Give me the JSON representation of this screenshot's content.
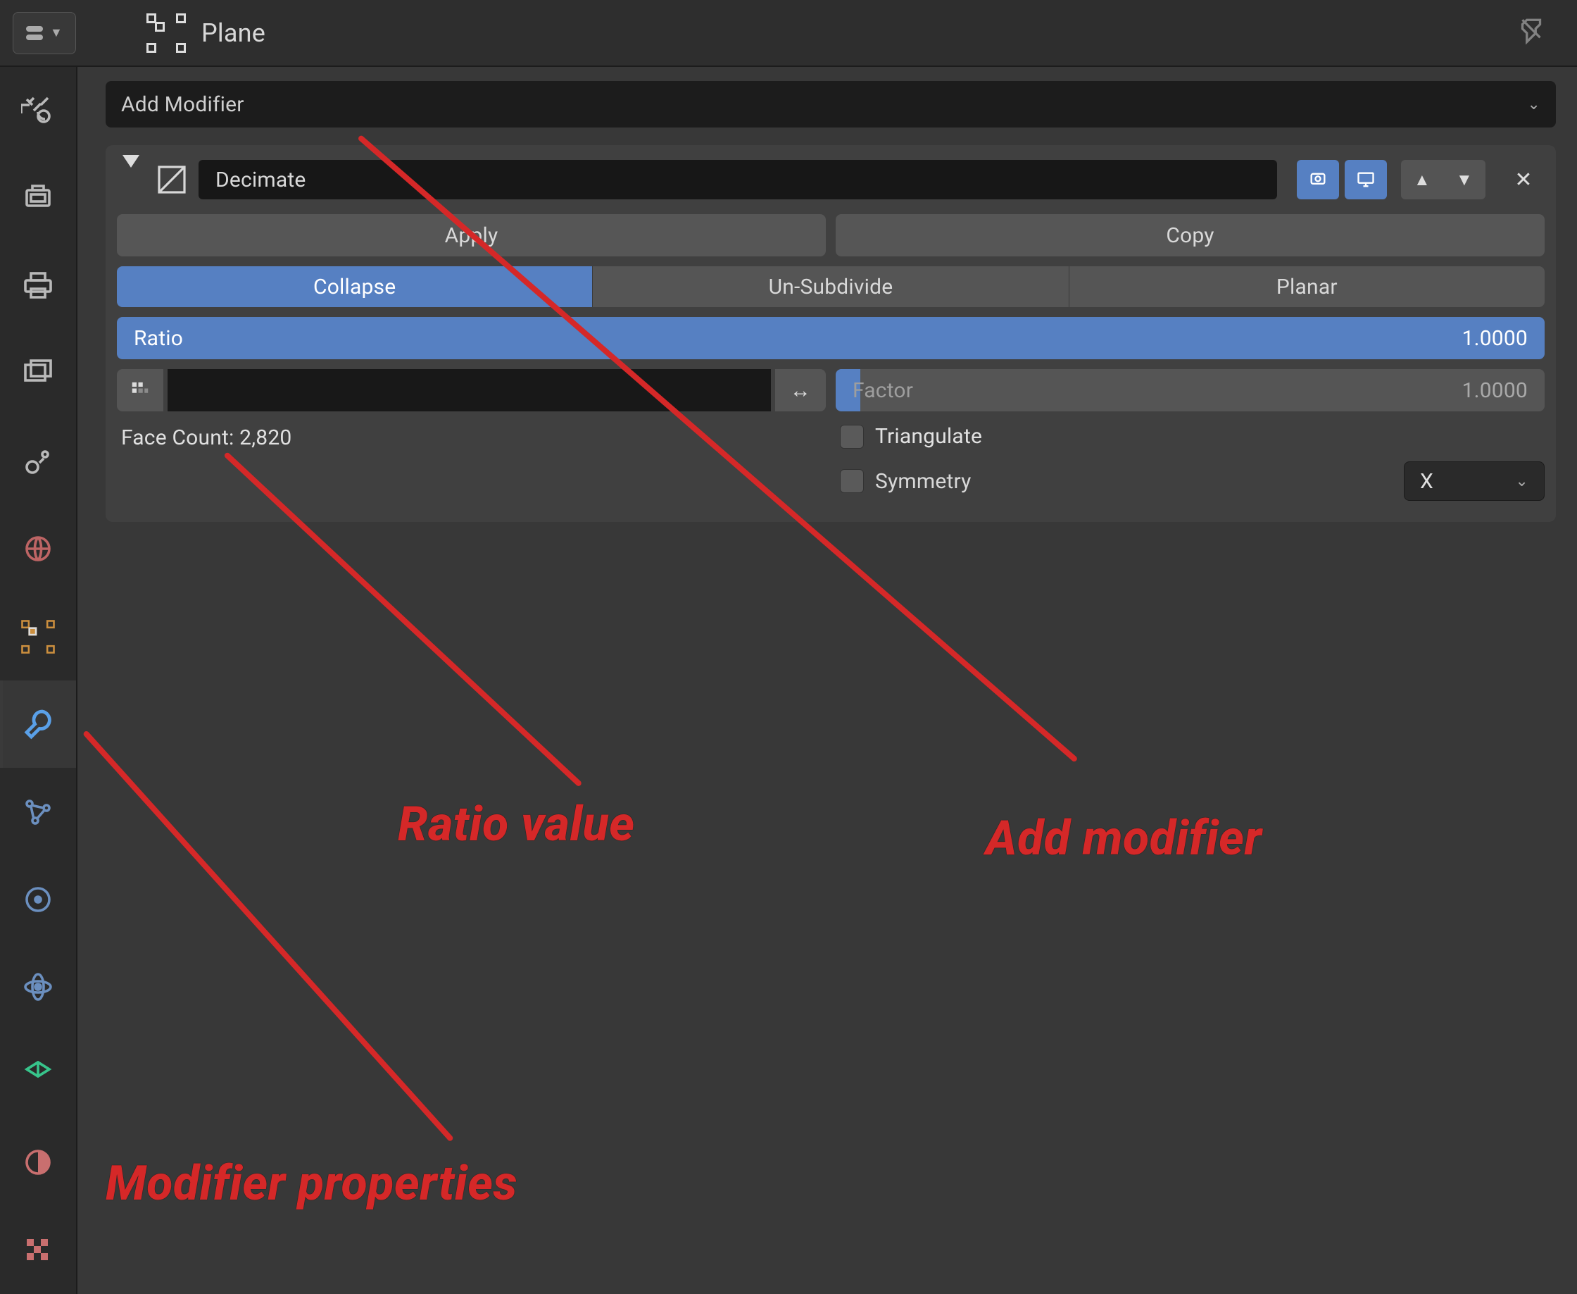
{
  "header": {
    "object_name": "Plane"
  },
  "panel": {
    "add_modifier_label": "Add Modifier",
    "modifier_name": "Decimate",
    "apply_label": "Apply",
    "copy_label": "Copy",
    "modes": {
      "collapse": "Collapse",
      "unsub": "Un-Subdivide",
      "planar": "Planar"
    },
    "ratio_label": "Ratio",
    "ratio_value": "1.0000",
    "face_count_label": "Face Count: 2,820",
    "factor_label": "Factor",
    "factor_value": "1.0000",
    "triangulate_label": "Triangulate",
    "symmetry_label": "Symmetry",
    "symmetry_axis": "X"
  },
  "annotations": {
    "ratio": "Ratio value",
    "add_modifier": "Add modifier",
    "modifier_properties": "Modifier properties"
  }
}
